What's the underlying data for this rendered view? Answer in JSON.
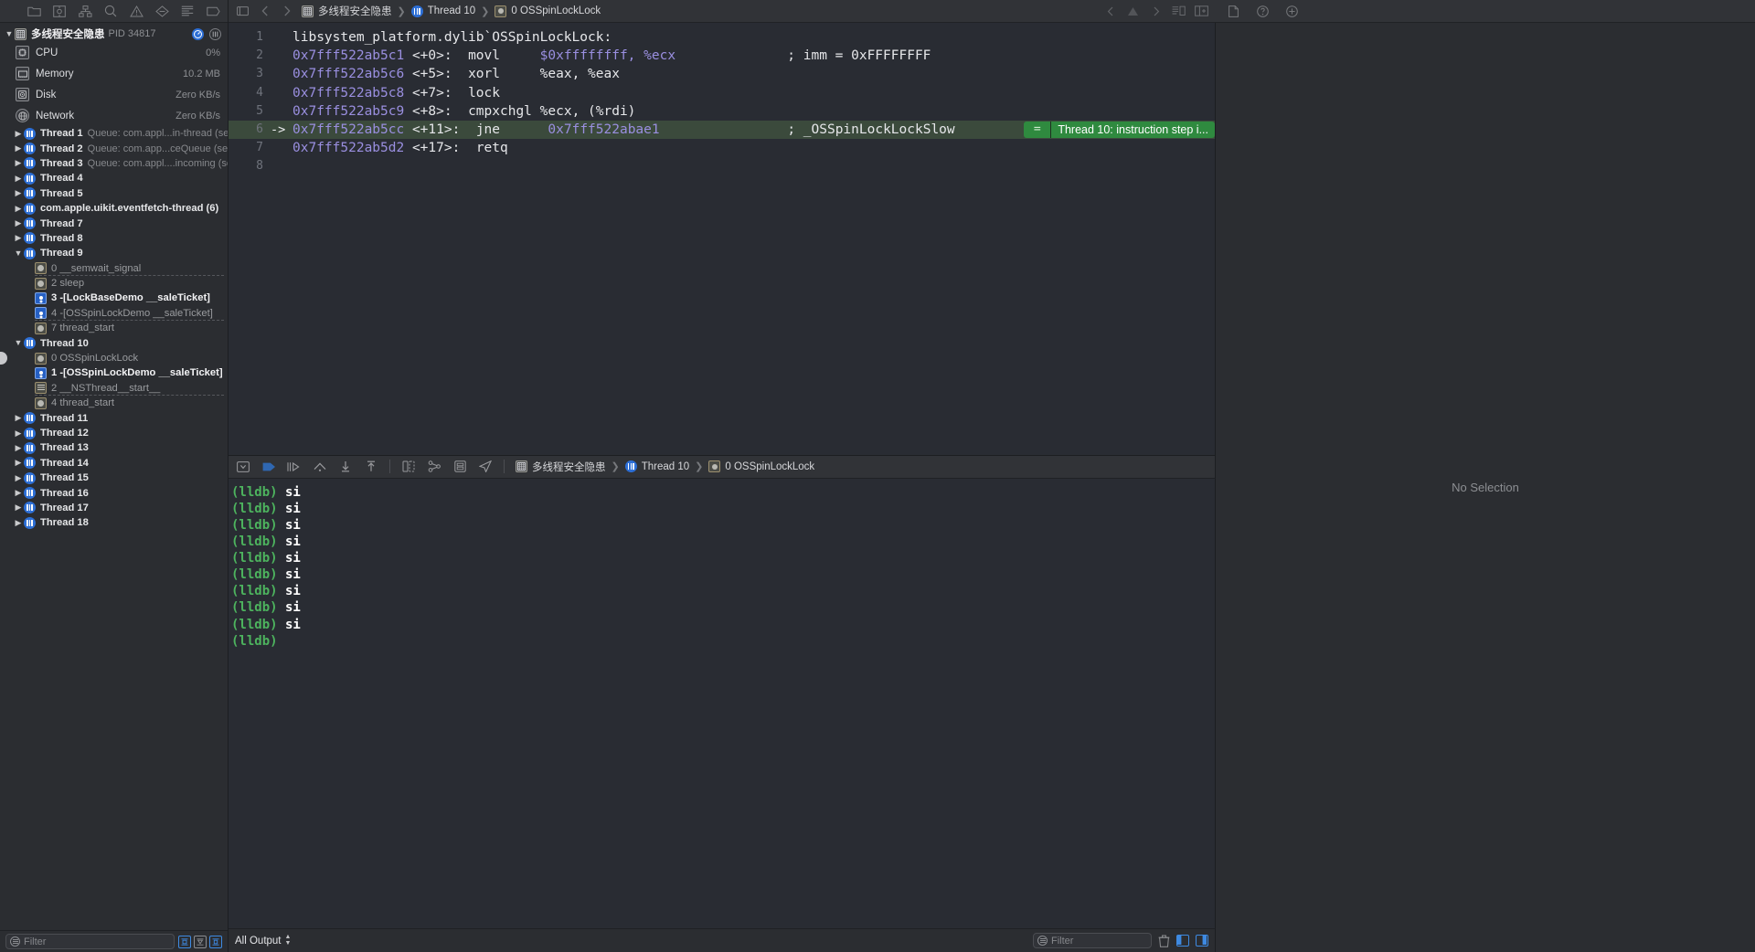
{
  "navigator": {
    "toolbar_icons": [
      "folder-icon",
      "source-control-icon",
      "symbol-hierarchy-icon",
      "search-icon",
      "warning-icon",
      "breakpoint-icon",
      "report-icon",
      "tag-icon"
    ],
    "process": {
      "name": "多线程安全隐患",
      "pid": "PID 34817"
    },
    "gauges": [
      {
        "label": "CPU",
        "value": "0%",
        "icon": "cpu-icon"
      },
      {
        "label": "Memory",
        "value": "10.2 MB",
        "icon": "memory-icon"
      },
      {
        "label": "Disk",
        "value": "Zero KB/s",
        "icon": "disk-icon"
      },
      {
        "label": "Network",
        "value": "Zero KB/s",
        "icon": "network-icon"
      }
    ],
    "threads": [
      {
        "label": "Thread 1",
        "queue": "Queue: com.appl...in-thread (serial)",
        "expanded": false,
        "frames": []
      },
      {
        "label": "Thread 2",
        "queue": "Queue: com.app...ceQueue (serial)",
        "expanded": false,
        "frames": []
      },
      {
        "label": "Thread 3",
        "queue": "Queue: com.appl....incoming (serial)",
        "expanded": false,
        "frames": []
      },
      {
        "label": "Thread 4",
        "queue": "",
        "expanded": false,
        "frames": []
      },
      {
        "label": "Thread 5",
        "queue": "",
        "expanded": false,
        "frames": []
      },
      {
        "label": "com.apple.uikit.eventfetch-thread (6)",
        "queue": "",
        "expanded": false,
        "frames": []
      },
      {
        "label": "Thread 7",
        "queue": "",
        "expanded": false,
        "frames": []
      },
      {
        "label": "Thread 8",
        "queue": "",
        "expanded": false,
        "frames": []
      },
      {
        "label": "Thread 9",
        "queue": "",
        "expanded": true,
        "marker": false,
        "frames": [
          {
            "text": "0 __semwait_signal",
            "kind": "sys",
            "active": false,
            "sep": true
          },
          {
            "text": "2 sleep",
            "kind": "sys",
            "active": false,
            "sep": false
          },
          {
            "text": "3 -[LockBaseDemo __saleTicket]",
            "kind": "user",
            "active": true,
            "sep": false
          },
          {
            "text": "4 -[OSSpinLockDemo __saleTicket]",
            "kind": "user",
            "active": false,
            "sep": true
          },
          {
            "text": "7 thread_start",
            "kind": "sys",
            "active": false,
            "sep": false
          }
        ]
      },
      {
        "label": "Thread 10",
        "queue": "",
        "expanded": true,
        "marker": true,
        "frames": [
          {
            "text": "0 OSSpinLockLock",
            "kind": "sys",
            "active": false,
            "sep": false,
            "marker": true
          },
          {
            "text": "1 -[OSSpinLockDemo __saleTicket]",
            "kind": "user",
            "active": true,
            "sep": false
          },
          {
            "text": "2 __NSThread__start__",
            "kind": "nsthread",
            "active": false,
            "sep": true
          },
          {
            "text": "4 thread_start",
            "kind": "sys",
            "active": false,
            "sep": false
          }
        ]
      },
      {
        "label": "Thread 11",
        "queue": "",
        "expanded": false,
        "frames": []
      },
      {
        "label": "Thread 12",
        "queue": "",
        "expanded": false,
        "frames": []
      },
      {
        "label": "Thread 13",
        "queue": "",
        "expanded": false,
        "frames": []
      },
      {
        "label": "Thread 14",
        "queue": "",
        "expanded": false,
        "frames": []
      },
      {
        "label": "Thread 15",
        "queue": "",
        "expanded": false,
        "frames": []
      },
      {
        "label": "Thread 16",
        "queue": "",
        "expanded": false,
        "frames": []
      },
      {
        "label": "Thread 17",
        "queue": "",
        "expanded": false,
        "frames": []
      },
      {
        "label": "Thread 18",
        "queue": "",
        "expanded": false,
        "frames": []
      }
    ],
    "footer": {
      "filter_placeholder": "Filter",
      "buttons": [
        "filter-recent-icon",
        "filter-mixed-icon",
        "filter-stack-icon"
      ]
    }
  },
  "jump_bar": {
    "left_icons": [
      "related-items-icon",
      "nav-back-icon",
      "nav-forward-icon"
    ],
    "crumbs": [
      {
        "label": "多线程安全隐患",
        "icon": "project-icon"
      },
      {
        "label": "Thread 10",
        "icon": "thread-icon"
      },
      {
        "label": "0 OSSpinLockLock",
        "icon": "frame-icon"
      }
    ],
    "right_icons": [
      "prev-issue-icon",
      "issue-icon",
      "next-issue-icon",
      "editor-mode-icon",
      "add-editor-icon"
    ]
  },
  "editor": {
    "lines": [
      {
        "num": "1",
        "arrow": "",
        "addr": "",
        "off": "",
        "mn": "",
        "args": "",
        "comment": "",
        "header": "libsystem_platform.dylib`OSSpinLockLock:"
      },
      {
        "num": "2",
        "arrow": "",
        "addr": "0x7fff522ab5c1",
        "off": "<+0>:",
        "mn": "movl",
        "args": "$0xffffffff, %ecx",
        "comment": "; imm = 0xFFFFFFFF"
      },
      {
        "num": "3",
        "arrow": "",
        "addr": "0x7fff522ab5c6",
        "off": "<+5>:",
        "mn": "xorl",
        "args": "%eax, %eax",
        "comment": ""
      },
      {
        "num": "4",
        "arrow": "",
        "addr": "0x7fff522ab5c8",
        "off": "<+7>:",
        "mn": "lock",
        "args": "",
        "comment": ""
      },
      {
        "num": "5",
        "arrow": "",
        "addr": "0x7fff522ab5c9",
        "off": "<+8>:",
        "mn": "cmpxchgl",
        "args": "%ecx, (%rdi)",
        "comment": ""
      },
      {
        "num": "6",
        "arrow": "->",
        "addr": "0x7fff522ab5cc",
        "off": "<+11>:",
        "mn": "jne",
        "args": "0x7fff522abae1",
        "comment": "; _OSSpinLockLockSlow",
        "highlight": true
      },
      {
        "num": "7",
        "arrow": "",
        "addr": "0x7fff522ab5d2",
        "off": "<+17>:",
        "mn": "retq",
        "args": "",
        "comment": ""
      },
      {
        "num": "8",
        "arrow": "",
        "addr": "",
        "off": "",
        "mn": "",
        "args": "",
        "comment": ""
      }
    ],
    "step_badge": {
      "equals": "=",
      "text": "Thread 10: instruction step i..."
    },
    "highlight_color": "#3b4a3c",
    "badge_color": "#2f8a3f"
  },
  "debug_bar": {
    "icons": [
      "hide-debug-icon",
      "continue-icon",
      "step-over-icon",
      "step-into-icon",
      "step-out-icon",
      "step-out-inst-icon",
      "simulate-location-icon",
      "view-hierarchy-icon",
      "memory-graph-icon",
      "location-icon"
    ],
    "crumbs": [
      {
        "label": "多线程安全隐患",
        "icon": "project-icon"
      },
      {
        "label": "Thread 10",
        "icon": "thread-icon"
      },
      {
        "label": "0 OSSpinLockLock",
        "icon": "frame-icon"
      }
    ]
  },
  "console": {
    "lines": [
      {
        "prompt": "(lldb)",
        "cmd": " si"
      },
      {
        "prompt": "(lldb)",
        "cmd": " si"
      },
      {
        "prompt": "(lldb)",
        "cmd": " si"
      },
      {
        "prompt": "(lldb)",
        "cmd": " si"
      },
      {
        "prompt": "(lldb)",
        "cmd": " si"
      },
      {
        "prompt": "(lldb)",
        "cmd": " si"
      },
      {
        "prompt": "(lldb)",
        "cmd": " si"
      },
      {
        "prompt": "(lldb)",
        "cmd": " si"
      },
      {
        "prompt": "(lldb)",
        "cmd": " si"
      },
      {
        "prompt": "(lldb)",
        "cmd": ""
      }
    ],
    "footer": {
      "output_mode": "All Output",
      "filter_placeholder": "Filter",
      "icons": [
        "trash-icon",
        "variables-pane-icon",
        "console-pane-icon"
      ]
    }
  },
  "inspector": {
    "toolbar_icons": [
      "file-inspector-icon",
      "help-inspector-icon",
      "quick-help-icon"
    ],
    "empty_message": "No Selection"
  }
}
